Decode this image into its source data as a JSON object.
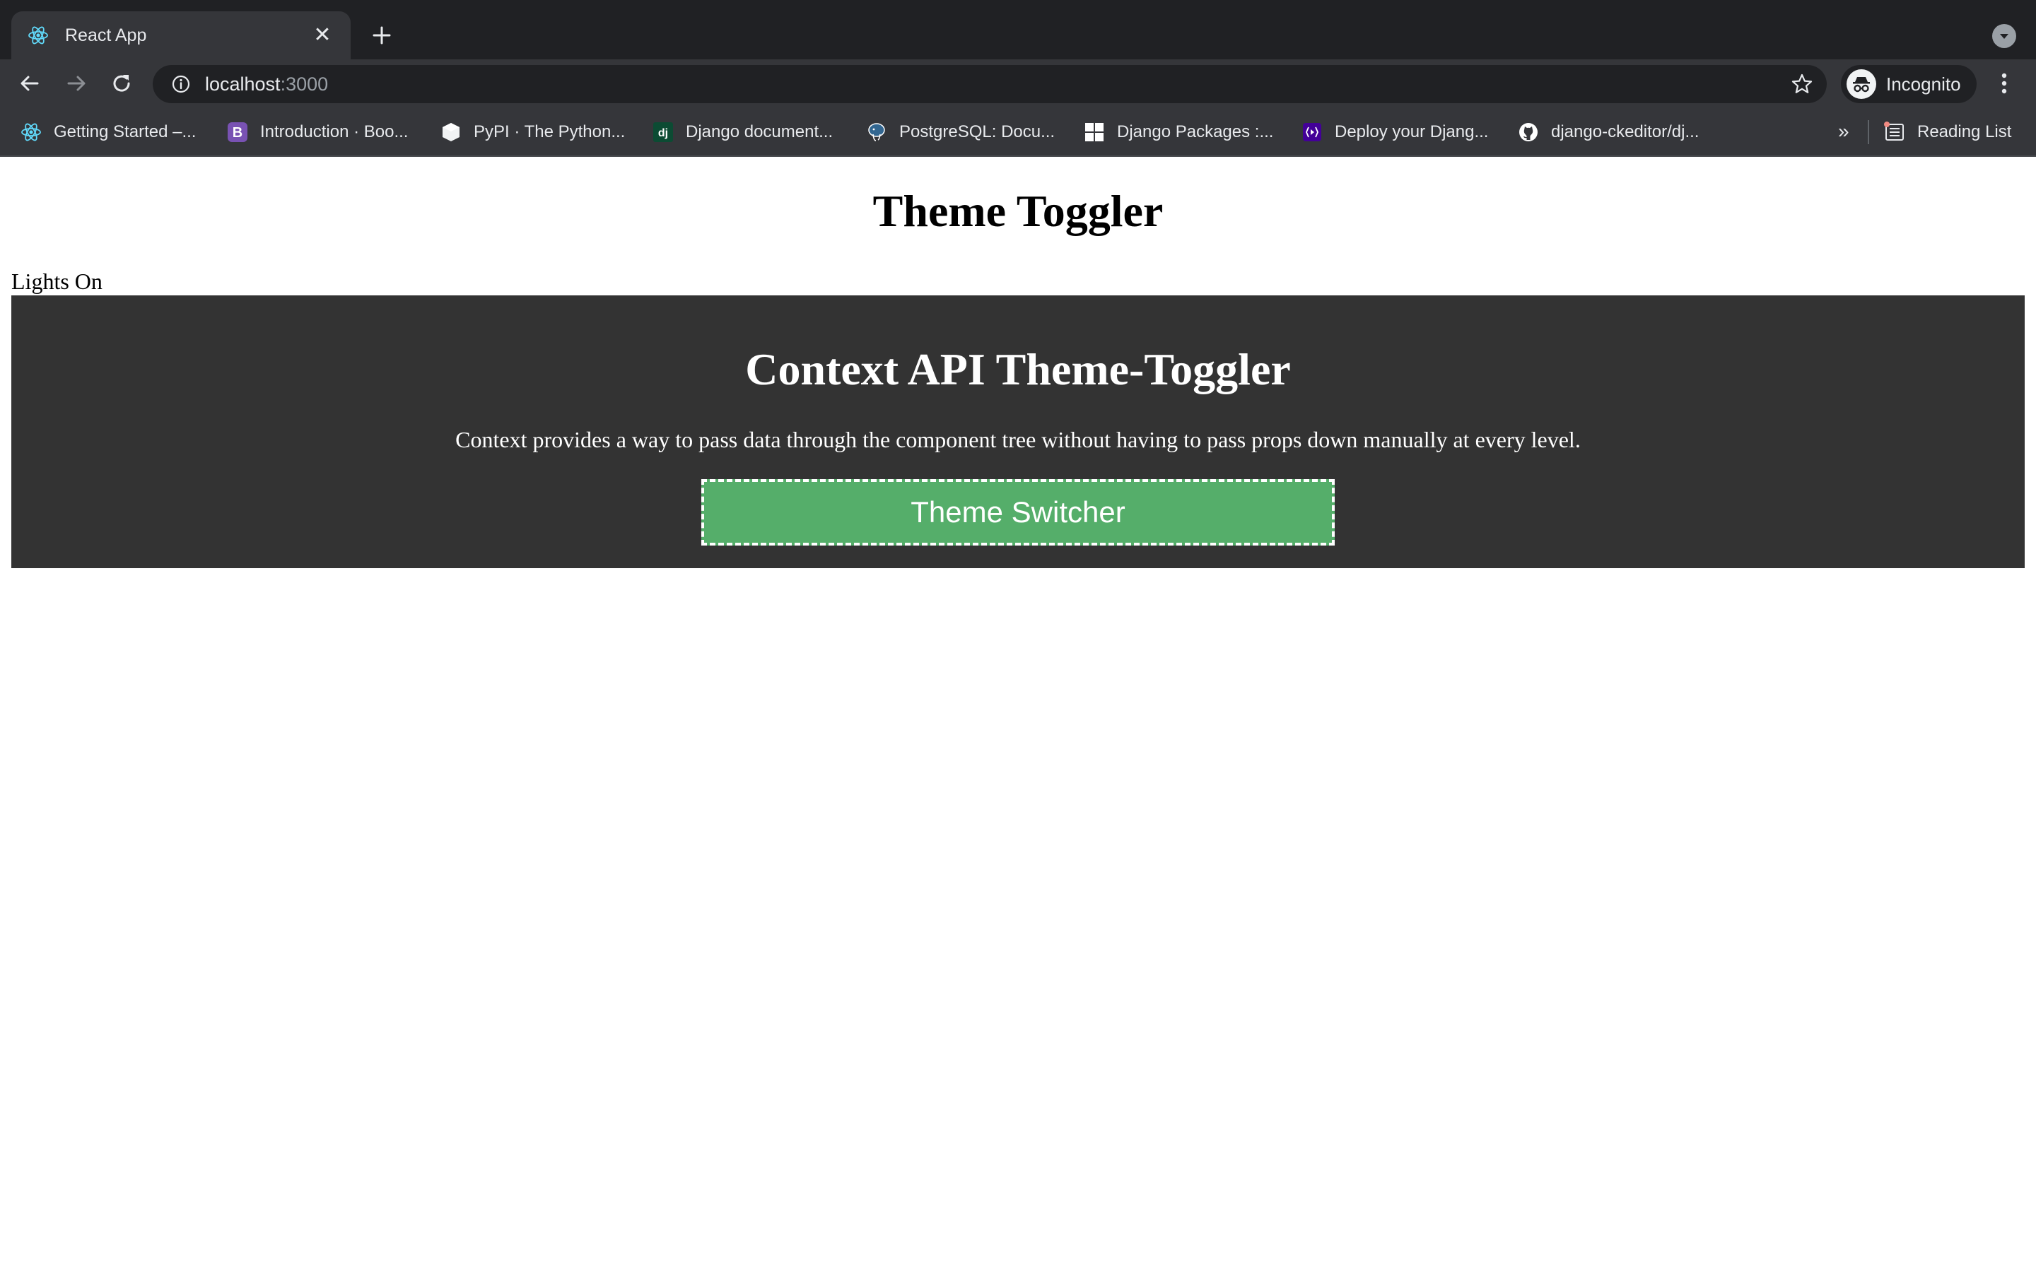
{
  "browser": {
    "tab": {
      "title": "React App",
      "close_glyph": "✕",
      "favicon": "react-icon"
    },
    "new_tab_icon": "plus-icon",
    "omnibox": {
      "host": "localhost",
      "port": ":3000"
    },
    "profile": {
      "label": "Incognito",
      "icon": "incognito-icon"
    }
  },
  "bookmarks": {
    "items": [
      {
        "label": "Getting Started –...",
        "icon": "react-icon"
      },
      {
        "label": "Introduction · Boo...",
        "icon": "bootstrap-icon"
      },
      {
        "label": "PyPI · The Python...",
        "icon": "pypi-icon"
      },
      {
        "label": "Django document...",
        "icon": "django-icon"
      },
      {
        "label": "PostgreSQL: Docu...",
        "icon": "postgresql-icon"
      },
      {
        "label": "Django Packages :...",
        "icon": "django-packages-icon"
      },
      {
        "label": "Deploy your Djang...",
        "icon": "deploy-icon"
      },
      {
        "label": "django-ckeditor/dj...",
        "icon": "github-icon"
      }
    ],
    "overflow": "»",
    "reading_list": "Reading List"
  },
  "page": {
    "title": "Theme Toggler",
    "status": "Lights On",
    "panel": {
      "title": "Context API Theme-Toggler",
      "description": "Context provides a way to pass data through the component tree without having to pass props down manually at every level.",
      "button_label": "Theme Switcher"
    }
  },
  "colors": {
    "tabstrip": "#202124",
    "toolbar": "#35363a",
    "panel_bg": "#333333",
    "button_bg": "#55ae6a"
  }
}
